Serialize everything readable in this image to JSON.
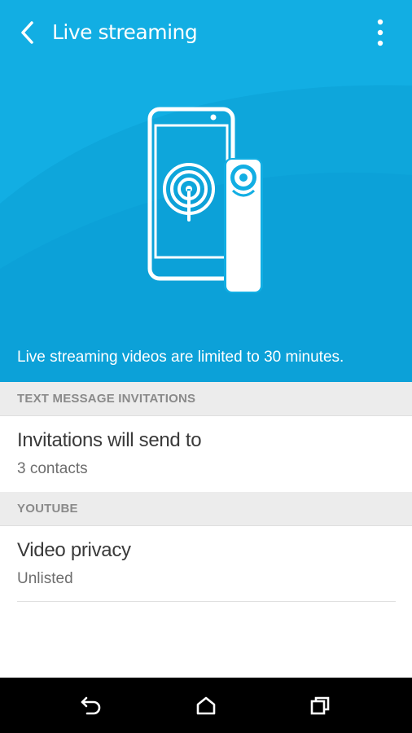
{
  "appbar": {
    "title": "Live streaming",
    "back_icon": "back-arrow-icon",
    "overflow_icon": "more-vert-icon"
  },
  "hero": {
    "illustration": "phone-and-camera-broadcast-illustration",
    "caption": "Live streaming videos are limited to 30 minutes."
  },
  "sections": [
    {
      "header": "TEXT MESSAGE INVITATIONS",
      "items": [
        {
          "primary": "Invitations will send to",
          "secondary": "3 contacts"
        }
      ]
    },
    {
      "header": "YOUTUBE",
      "items": [
        {
          "primary": "Video privacy",
          "secondary": "Unlisted"
        }
      ]
    }
  ],
  "navbar": {
    "back_icon": "nav-back-icon",
    "home_icon": "nav-home-icon",
    "recents_icon": "nav-recents-icon"
  },
  "colors": {
    "accent": "#12aee3",
    "section_bg": "#ececec",
    "navbar": "#000000"
  }
}
